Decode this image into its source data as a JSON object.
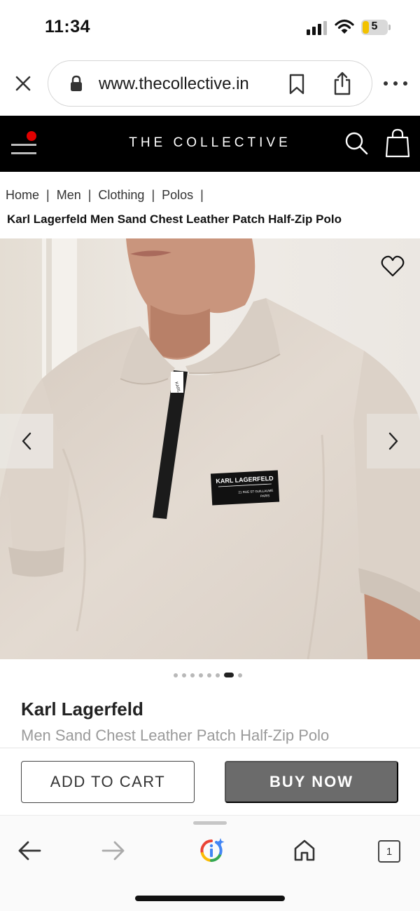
{
  "status_bar": {
    "time": "11:34",
    "battery_level": "5",
    "signal_icon": "cellular-signal-icon",
    "wifi_icon": "wifi-icon",
    "battery_icon": "battery-icon"
  },
  "browser": {
    "url": "www.thecollective.in",
    "close_icon": "close-icon",
    "lock_icon": "lock-icon",
    "bookmark_icon": "bookmark-icon",
    "share_icon": "share-icon",
    "more_icon": "more-dots-icon"
  },
  "site_header": {
    "brand": "THE COLLECTIVE",
    "menu_icon": "hamburger-menu-icon",
    "search_icon": "search-icon",
    "bag_icon": "shopping-bag-icon"
  },
  "breadcrumb": {
    "items": [
      "Home",
      "Men",
      "Clothing",
      "Polos"
    ],
    "separator": "|"
  },
  "product": {
    "heading": "Karl Lagerfeld Men Sand Chest Leather Patch Half-Zip Polo",
    "brand": "Karl Lagerfeld",
    "subtitle": "Men Sand Chest Leather Patch Half-Zip Polo",
    "patch_brand": "KARL LAGERFELD",
    "patch_address": "21 RUE ST GUILLAUME",
    "patch_city": "PARIS",
    "zip_label": "KARL",
    "image_count": 8,
    "active_image_index": 6,
    "wishlist_icon": "heart-outline-icon",
    "prev_icon": "chevron-left-icon",
    "next_icon": "chevron-right-icon"
  },
  "actions": {
    "add_to_cart": "ADD TO CART",
    "buy_now": "BUY NOW"
  },
  "bottom_nav": {
    "tab_count": "1",
    "back_icon": "arrow-left-icon",
    "forward_icon": "arrow-right-icon",
    "lens_icon": "google-lens-icon",
    "home_icon": "home-icon"
  },
  "colors": {
    "header_bg": "#000000",
    "notification_dot": "#e10000",
    "buy_now_bg": "#6b6b6b",
    "shirt": "#ddd3c9"
  }
}
